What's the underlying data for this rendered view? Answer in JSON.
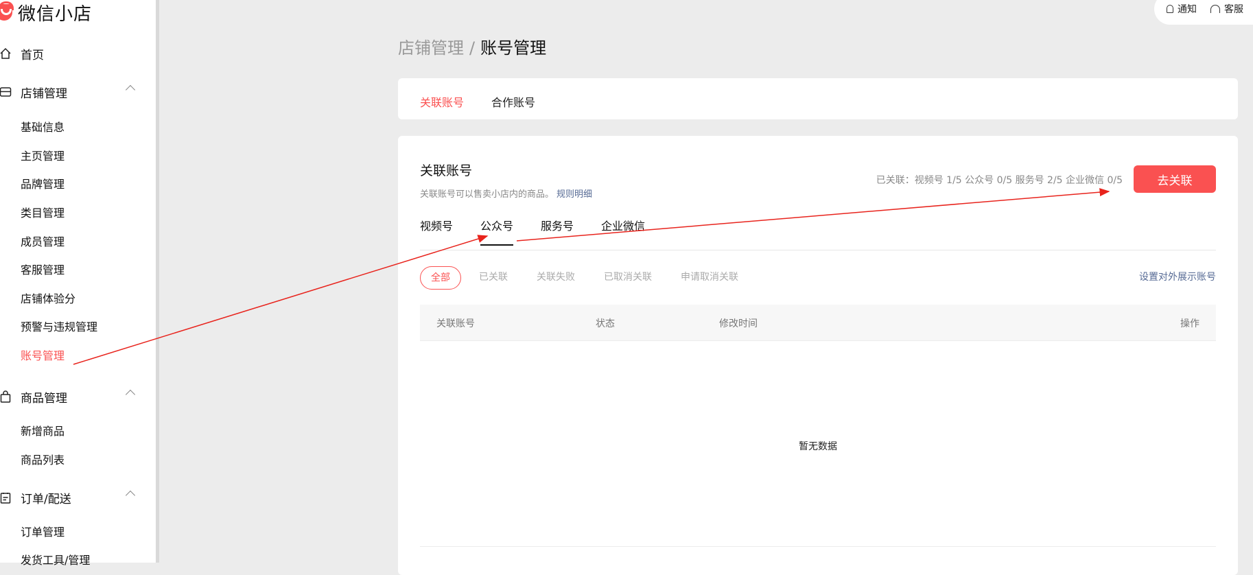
{
  "app": {
    "name": "微信小店"
  },
  "header": {
    "notify": "通知",
    "service": "客服"
  },
  "sidebar": {
    "groups": [
      {
        "label": "首页",
        "icon": "home-icon"
      },
      {
        "label": "店铺管理",
        "icon": "store-icon"
      },
      {
        "label": "商品管理",
        "icon": "bag-icon"
      },
      {
        "label": "订单/配送",
        "icon": "clipboard-icon"
      }
    ],
    "store_items": [
      "基础信息",
      "主页管理",
      "品牌管理",
      "类目管理",
      "成员管理",
      "客服管理",
      "店铺体验分",
      "预警与违规管理",
      "账号管理"
    ],
    "goods_items": [
      "新增商品",
      "商品列表"
    ],
    "order_items": [
      "订单管理",
      "发货工具/管理"
    ]
  },
  "breadcrumb": {
    "parent": "店铺管理",
    "separator": "/",
    "current": "账号管理"
  },
  "top_tabs": [
    "关联账号",
    "合作账号"
  ],
  "section": {
    "title": "关联账号",
    "desc": "关联账号可以售卖小店内的商品。",
    "rule_link": "规则明细",
    "status": "已关联：视频号 1/5 公众号 0/5 服务号 2/5 企业微信 0/5",
    "action": "去关联"
  },
  "account_tabs": [
    "视频号",
    "公众号",
    "服务号",
    "企业微信"
  ],
  "filters": [
    "全部",
    "已关联",
    "关联失败",
    "已取消关联",
    "申请取消关联"
  ],
  "set_display_link": "设置对外展示账号",
  "table": {
    "columns": [
      "关联账号",
      "状态",
      "修改时间",
      "操作"
    ],
    "empty": "暂无数据"
  },
  "colors": {
    "accent": "#fa5151",
    "link": "#576b95",
    "annotation": "#e8231c"
  }
}
